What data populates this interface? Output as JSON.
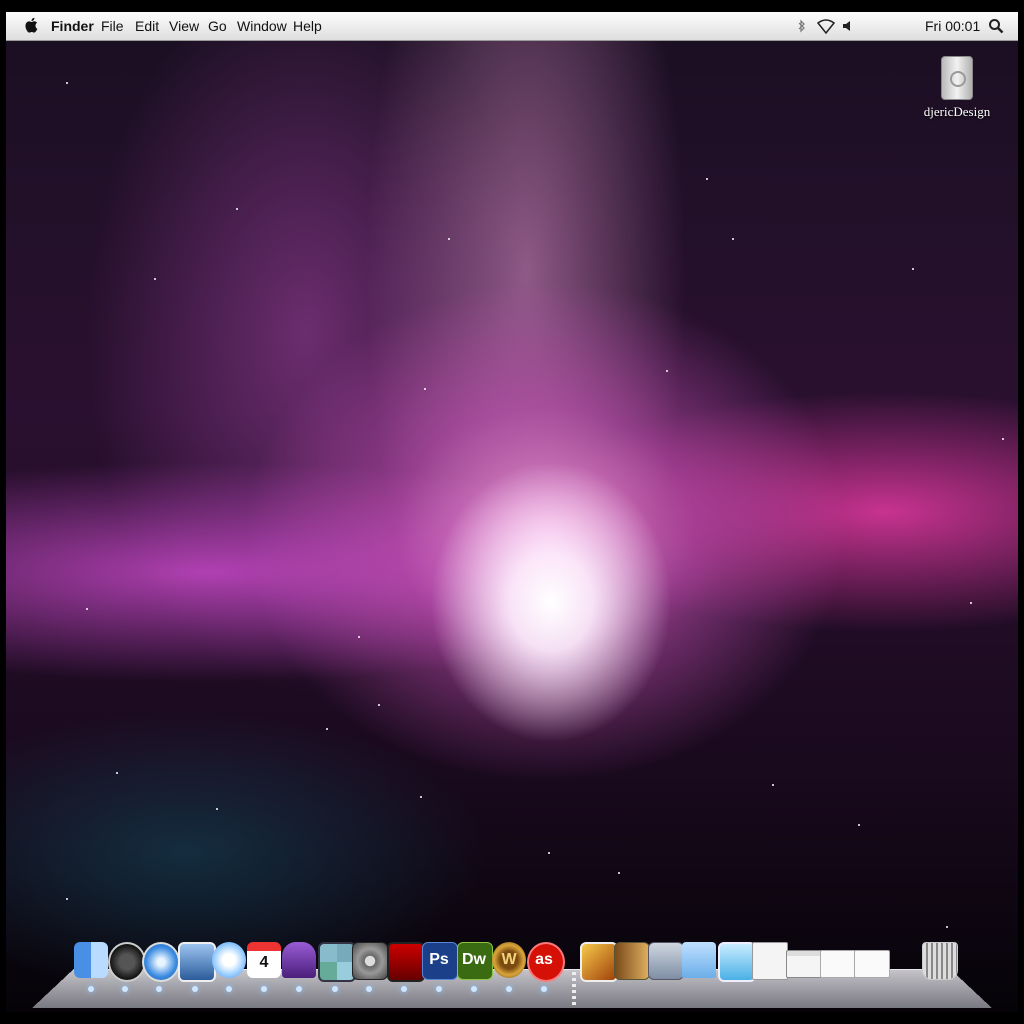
{
  "menubar": {
    "apple_icon": "apple-logo-icon",
    "app_name": "Finder",
    "menus": [
      "File",
      "Edit",
      "View",
      "Go",
      "Window",
      "Help"
    ],
    "status_icons": [
      "bluetooth-icon",
      "wifi-icon",
      "volume-icon"
    ],
    "clock": "Fri 00:01",
    "spotlight_icon": "spotlight-search-icon"
  },
  "desktop": {
    "drive_label": "djericDesign",
    "drive_icon": "hard-drive-icon"
  },
  "dock": {
    "calendar_day": "4",
    "photoshop_label": "Ps",
    "dreamweaver_label": "Dw",
    "wow_label": "W",
    "lastfm_label": "as",
    "apps": [
      "finder-icon",
      "dashboard-icon",
      "safari-icon",
      "mail-icon",
      "itunes-icon",
      "ical-icon",
      "adium-icon",
      "spaces-icon",
      "system-preferences-icon",
      "photo-booth-icon",
      "photoshop-icon",
      "dreamweaver-icon",
      "world-of-warcraft-icon",
      "lastfm-icon"
    ],
    "stacks": [
      "pictures-stack-icon",
      "address-book-icon",
      "network-icon",
      "documents-folder-icon",
      "downloads-icon",
      "text-document-icon",
      "window-preview-icon",
      "image-document-icon",
      "file-document-icon"
    ],
    "trash": "trash-icon"
  }
}
